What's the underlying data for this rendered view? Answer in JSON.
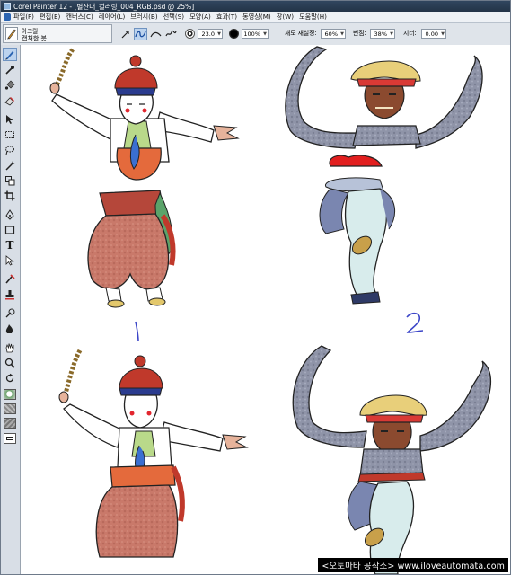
{
  "window": {
    "title": "Corel Painter 12 - [별산대_컬러링_004_RGB.psd @ 25%]"
  },
  "menu": {
    "items": [
      "파일(F)",
      "편집(E)",
      "캔버스(C)",
      "레이어(L)",
      "브러시(B)",
      "선택(S)",
      "모양(A)",
      "효과(T)",
      "동영상(M)",
      "창(W)",
      "도움말(H)"
    ]
  },
  "brush_selector": {
    "category": "아크릴",
    "variant": "캡처한 붓"
  },
  "property_bar": {
    "size_value": "23.0",
    "opacity_value": "100%",
    "resaturation_label": "재도 재설정:",
    "resaturation_value": "60%",
    "bleed_label": "번짐:",
    "bleed_value": "38%",
    "jitter_label": "지터:",
    "jitter_value": "0.00"
  },
  "toolbox": {
    "icons": [
      "brush-tool-icon",
      "dropper-tool-icon",
      "paint-bucket-icon",
      "eraser-icon",
      "layer-adjuster-icon",
      "rectangular-selection-icon",
      "lasso-icon",
      "magic-wand-icon",
      "transform-icon",
      "crop-icon",
      "pen-icon",
      "rectangle-shape-icon",
      "text-tool-icon",
      "shape-selection-icon",
      "cloner-icon",
      "rubber-stamp-icon",
      "dodge-icon",
      "burn-icon",
      "grabber-icon",
      "magnifier-icon",
      "rotate-page-icon"
    ]
  },
  "canvas": {
    "label_1": "1",
    "label_2": "2"
  },
  "watermark": {
    "text": "<오토마타 공작소> www.iloveautomata.com"
  },
  "colors": {
    "title_bar": "#2a3d54",
    "menu_bar": "#eef1f5",
    "toolbar": "#dfe4ea",
    "active_tool": "#bcd3ee",
    "label_ink": "#3c46c8"
  }
}
